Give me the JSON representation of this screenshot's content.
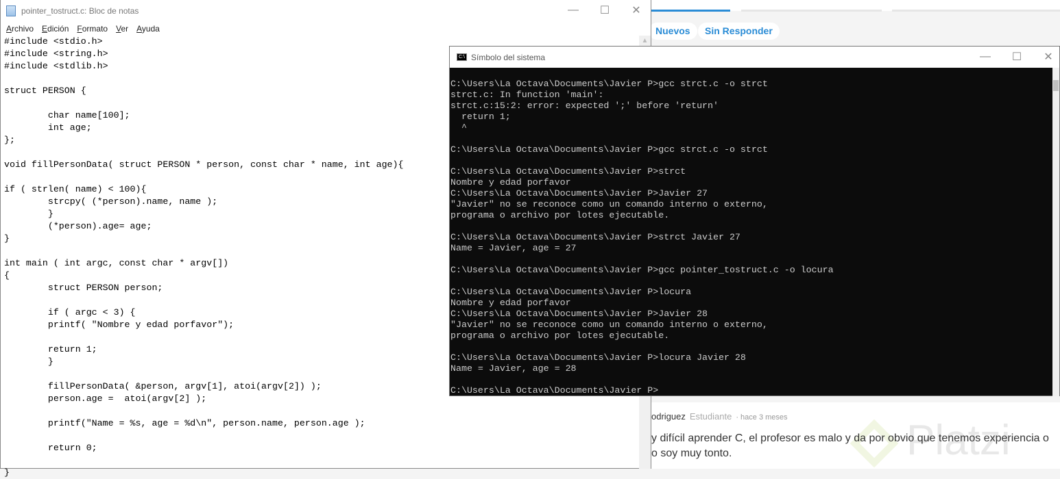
{
  "browser": {
    "filters": [
      "Nuevos",
      "Sin Responder"
    ],
    "accent": "#2a8cd6",
    "comment": {
      "author": "odriguez",
      "role": "Estudiante",
      "time": "· hace 3 meses",
      "text": "y difícil aprender C, el profesor es malo y da por obvio que tenemos experiencia o\no soy muy tonto."
    },
    "logo_text": "Platzi"
  },
  "notepad": {
    "title": "pointer_tostruct.c: Bloc de notas",
    "menu": [
      "Archivo",
      "Edición",
      "Formato",
      "Ver",
      "Ayuda"
    ],
    "code": "#include <stdio.h>\n#include <string.h>\n#include <stdlib.h>\n\nstruct PERSON {\n\n\tchar name[100];\n\tint age;\n};\n\nvoid fillPersonData( struct PERSON * person, const char * name, int age){\n\nif ( strlen( name) < 100){\n\tstrcpy( (*person).name, name );\n\t}\n\t(*person).age= age;\n}\n\nint main ( int argc, const char * argv[])\n{\n\tstruct PERSON person;\n\n\tif ( argc < 3) {\n\tprintf( \"Nombre y edad porfavor\");\n\n\treturn 1;\n\t}\n\n\tfillPersonData( &person, argv[1], atoi(argv[2]) );\n\tperson.age =  atoi(argv[2] );\n\n\tprintf(\"Name = %s, age = %d\\n\", person.name, person.age );\n\n\treturn 0;\n\n}"
  },
  "cmd": {
    "title": "Símbolo del sistema",
    "output": "C:\\Users\\La Octava\\Documents\\Javier P>gcc strct.c -o strct\nstrct.c: In function 'main':\nstrct.c:15:2: error: expected ';' before 'return'\n  return 1;\n  ^\n\nC:\\Users\\La Octava\\Documents\\Javier P>gcc strct.c -o strct\n\nC:\\Users\\La Octava\\Documents\\Javier P>strct\nNombre y edad porfavor\nC:\\Users\\La Octava\\Documents\\Javier P>Javier 27\n\"Javier\" no se reconoce como un comando interno o externo,\nprograma o archivo por lotes ejecutable.\n\nC:\\Users\\La Octava\\Documents\\Javier P>strct Javier 27\nName = Javier, age = 27\n\nC:\\Users\\La Octava\\Documents\\Javier P>gcc pointer_tostruct.c -o locura\n\nC:\\Users\\La Octava\\Documents\\Javier P>locura\nNombre y edad porfavor\nC:\\Users\\La Octava\\Documents\\Javier P>Javier 28\n\"Javier\" no se reconoce como un comando interno o externo,\nprograma o archivo por lotes ejecutable.\n\nC:\\Users\\La Octava\\Documents\\Javier P>locura Javier 28\nName = Javier, age = 28\n\nC:\\Users\\La Octava\\Documents\\Javier P>"
  }
}
